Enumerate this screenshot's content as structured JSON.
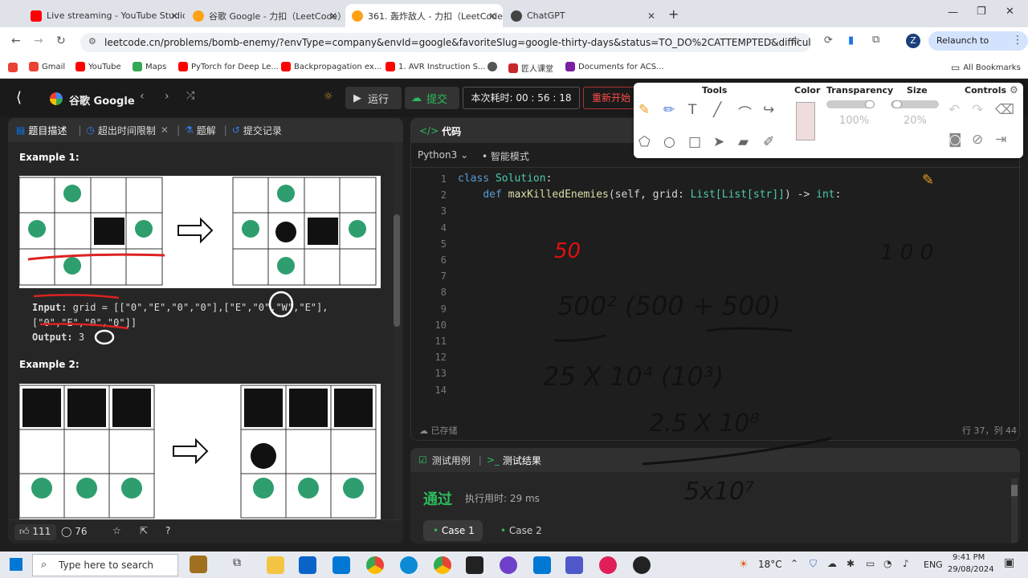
{
  "tabs": [
    {
      "title": "Live streaming - YouTube Studio",
      "color": "#ff0000"
    },
    {
      "title": "谷歌 Google - 力扣（LeetCode）",
      "color": "#ffffff"
    },
    {
      "title": "361. 轰炸敌人 - 力扣（LeetCode）",
      "color": "#ffffff",
      "active": true
    },
    {
      "title": "ChatGPT",
      "color": "#ffffff"
    }
  ],
  "url": "leetcode.cn/problems/bomb-enemy/?envType=company&envId=google&favoriteSlug=google-thirty-days&status=TO_DO%2CATTEMPTED&difficulty=MED...",
  "relaunch": "Relaunch to update",
  "profile": "Z",
  "bookmarks": [
    "Gmail",
    "YouTube",
    "Maps",
    "PyTorch for Deep Le...",
    "Backpropagation ex...",
    "1. AVR Instruction S...",
    "匠人课堂",
    "Documents for ACS...",
    "All Bookmarks"
  ],
  "lc": {
    "company": "谷歌 Google",
    "run": "运行",
    "submit": "提交",
    "timer": "本次耗时: 00 : 56 : 18",
    "restart": "重新开始"
  },
  "lefttabs": [
    "题目描述",
    "超出时间限制",
    "题解",
    "提交记录"
  ],
  "example1": {
    "title": "Example 1:",
    "input_label": "Input:",
    "input": "grid = [[\"0\",\"E\",\"0\",\"0\"],[\"E\",\"0\",\"W\",\"E\"],",
    "input2": "[\"0\",\"E\",\"0\",\"0\"]]",
    "output_label": "Output:",
    "output": "3"
  },
  "example2": {
    "title": "Example 2:"
  },
  "likes": "111",
  "comments": "76",
  "code": {
    "tab": "代码",
    "lang": "Python3",
    "mode": "智能模式",
    "lines": [
      "class Solution:",
      "    def maxKilledEnemies(self, grid: List[List[str]]) -> int:",
      "",
      "",
      "",
      "",
      "",
      "",
      "",
      "",
      "",
      "",
      "",
      ""
    ],
    "saved": "已存储",
    "pos": "行 37，列 44"
  },
  "test": {
    "tab1": "测试用例",
    "tab2": "测试结果",
    "status": "通过",
    "runtime": "执行用时: 29 ms",
    "case1": "Case 1",
    "case2": "Case 2"
  },
  "toolbox": {
    "tools": "Tools",
    "color": "Color",
    "transparency": "Transparency",
    "size": "Size",
    "controls": "Controls",
    "trans_val": "100%",
    "size_val": "20%"
  },
  "handwriting": [
    "50",
    "500²  (500 + 500)",
    "25 X 10⁴  (10³)",
    "2.5 X 10⁸",
    "5x10⁷",
    "1 0 0"
  ],
  "taskbar": {
    "search": "Type here to search",
    "weather": "18°C",
    "lang": "ENG",
    "time": "9:41 PM",
    "date": "29/08/2024"
  }
}
